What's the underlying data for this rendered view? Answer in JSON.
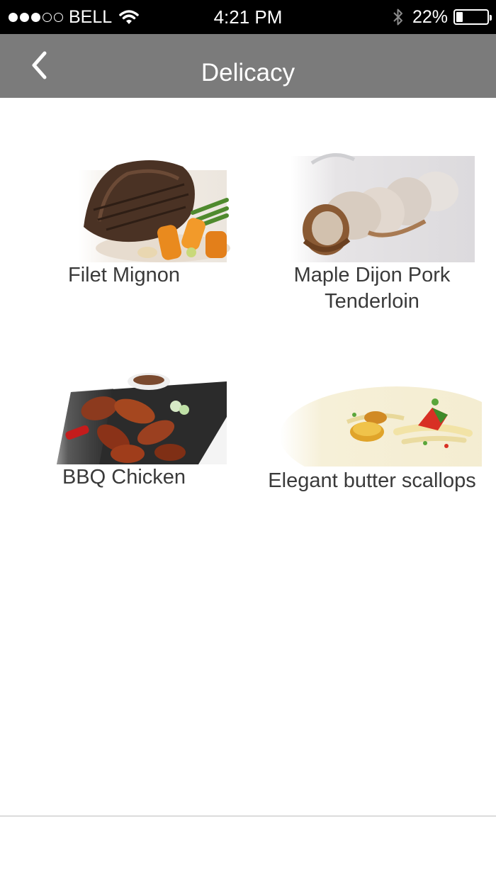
{
  "status_bar": {
    "signal_dots": [
      true,
      true,
      true,
      false,
      false
    ],
    "carrier": "BELL",
    "time": "4:21 PM",
    "battery_percent": "22%",
    "battery_level": 0.22
  },
  "nav": {
    "title": "Delicacy",
    "back_icon": "chevron-left-icon"
  },
  "menu_items": [
    {
      "label": "Filet Mignon",
      "image": "steak-photo"
    },
    {
      "label": "Maple Dijon Pork Tenderloin",
      "image": "pork-photo"
    },
    {
      "label": "BBQ Chicken",
      "image": "chicken-wings-photo"
    },
    {
      "label": "Elegant butter scallops",
      "image": "scallops-photo"
    }
  ],
  "colors": {
    "status_bar_bg": "#000000",
    "nav_bar_bg": "#7b7b7b",
    "label_text": "#3a3a3a"
  }
}
